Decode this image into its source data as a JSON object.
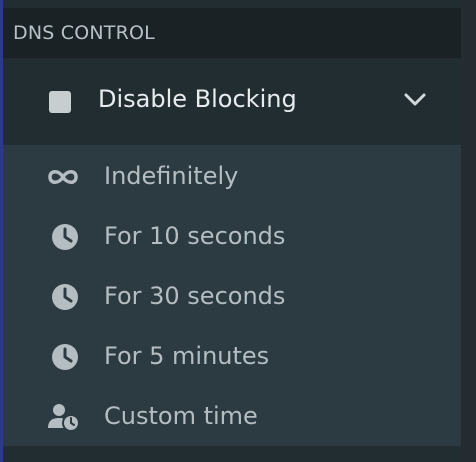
{
  "section": {
    "title": "DNS CONTROL"
  },
  "toggle": {
    "label": "Disable Blocking",
    "icon": "square-icon",
    "chevron": "chevron-down-icon"
  },
  "submenu": {
    "items": [
      {
        "label": "Indefinitely",
        "icon": "infinity-icon"
      },
      {
        "label": "For 10 seconds",
        "icon": "clock-icon"
      },
      {
        "label": "For 30 seconds",
        "icon": "clock-icon"
      },
      {
        "label": "For 5 minutes",
        "icon": "clock-icon"
      },
      {
        "label": "Custom time",
        "icon": "user-clock-icon"
      }
    ]
  },
  "colors": {
    "header_bg": "#1a2226",
    "toggle_bg": "#222d32",
    "submenu_bg": "#2c3b41",
    "icon": "#b4bdc2",
    "text": "#e8ecee"
  }
}
